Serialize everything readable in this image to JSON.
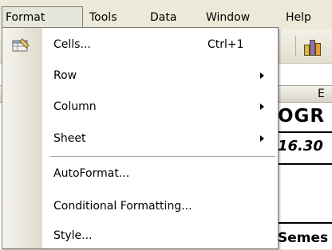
{
  "menubar": {
    "items": [
      {
        "label": "Format",
        "mnemonic": "o"
      },
      {
        "label": "Tools",
        "mnemonic": "T"
      },
      {
        "label": "Data",
        "mnemonic": "D"
      },
      {
        "label": "Window",
        "mnemonic": "W"
      },
      {
        "label": "Help",
        "mnemonic": "H"
      }
    ]
  },
  "format_menu": {
    "items": [
      {
        "label": "Cells...",
        "shortcut": "Ctrl+1",
        "icon": "format-cells-icon"
      },
      {
        "label": "Row",
        "submenu": true
      },
      {
        "label": "Column",
        "submenu": true
      },
      {
        "label": "Sheet",
        "submenu": true
      },
      {
        "label": "AutoFormat..."
      },
      {
        "label": "Conditional Formatting..."
      },
      {
        "label": "Style..."
      }
    ]
  },
  "sheet": {
    "column_header": "E",
    "title_cell": "OGR",
    "value_cell": "16.30",
    "semester_cell": "Semes"
  },
  "toolbar": {
    "chart_icon": "chart-wizard-icon"
  },
  "colors": {
    "menubar_bg": "#ece9d8",
    "dropdown_bg": "#ffffff",
    "border": "#7e7b73"
  }
}
